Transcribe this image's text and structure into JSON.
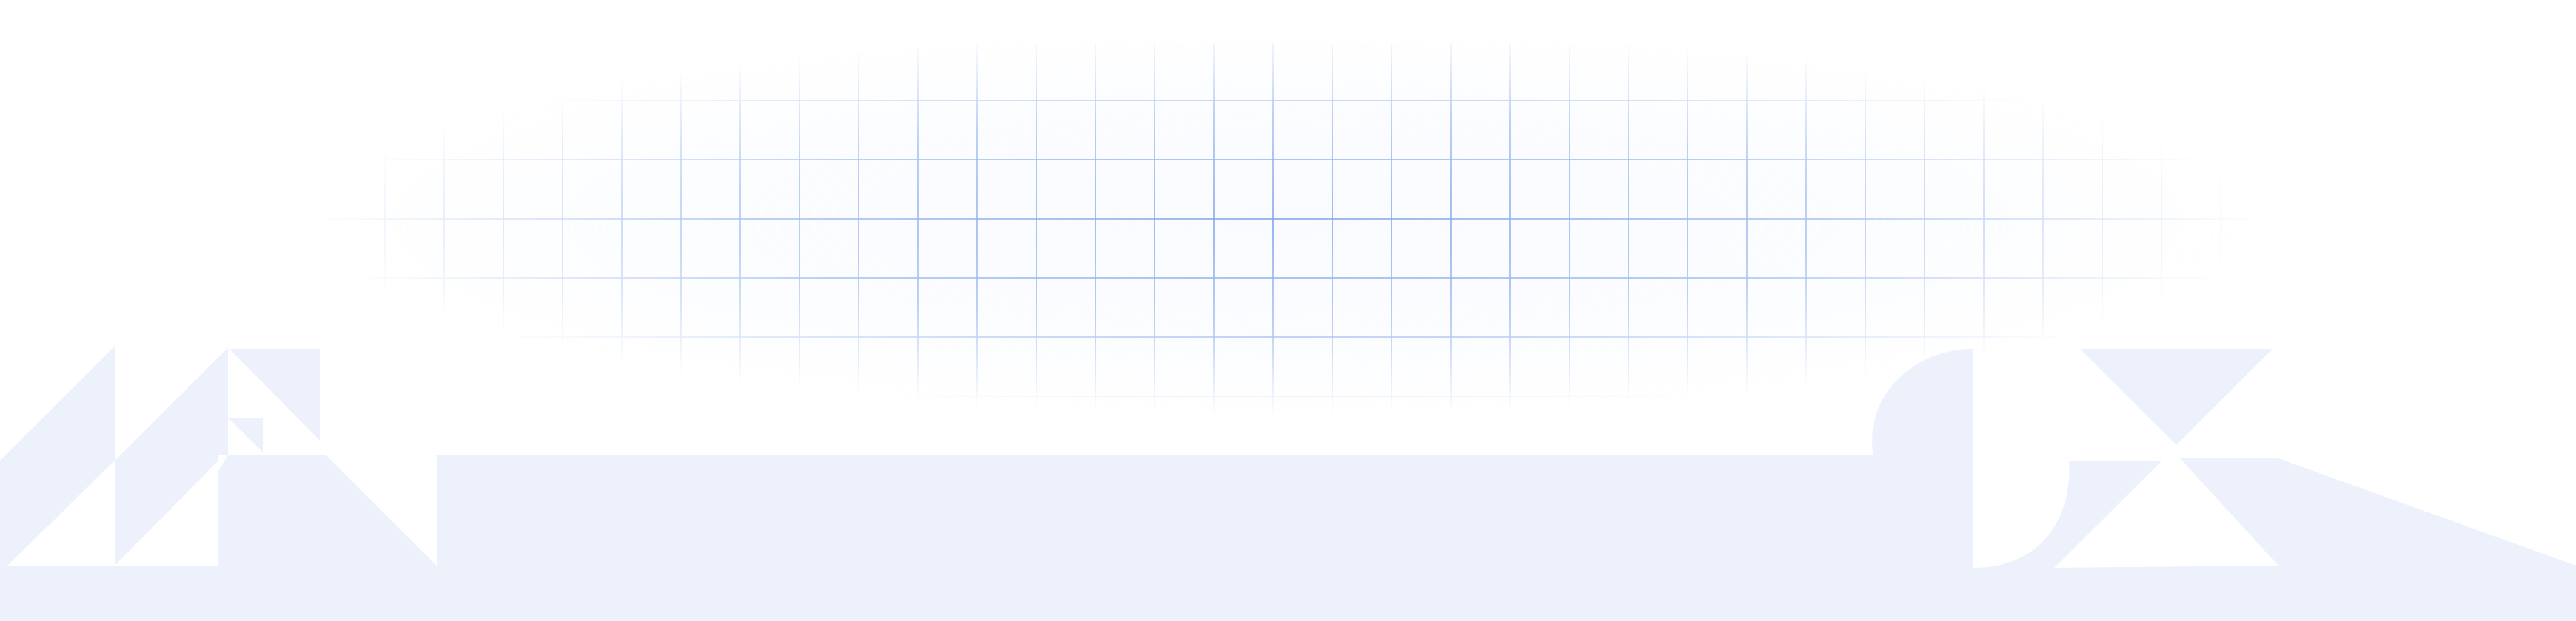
{
  "background": {
    "page_color": "#ffffff",
    "band_color": "#edf1fc",
    "grid_line_color": "#7aa0e8",
    "grid_fill_color": "#eef3ff"
  }
}
